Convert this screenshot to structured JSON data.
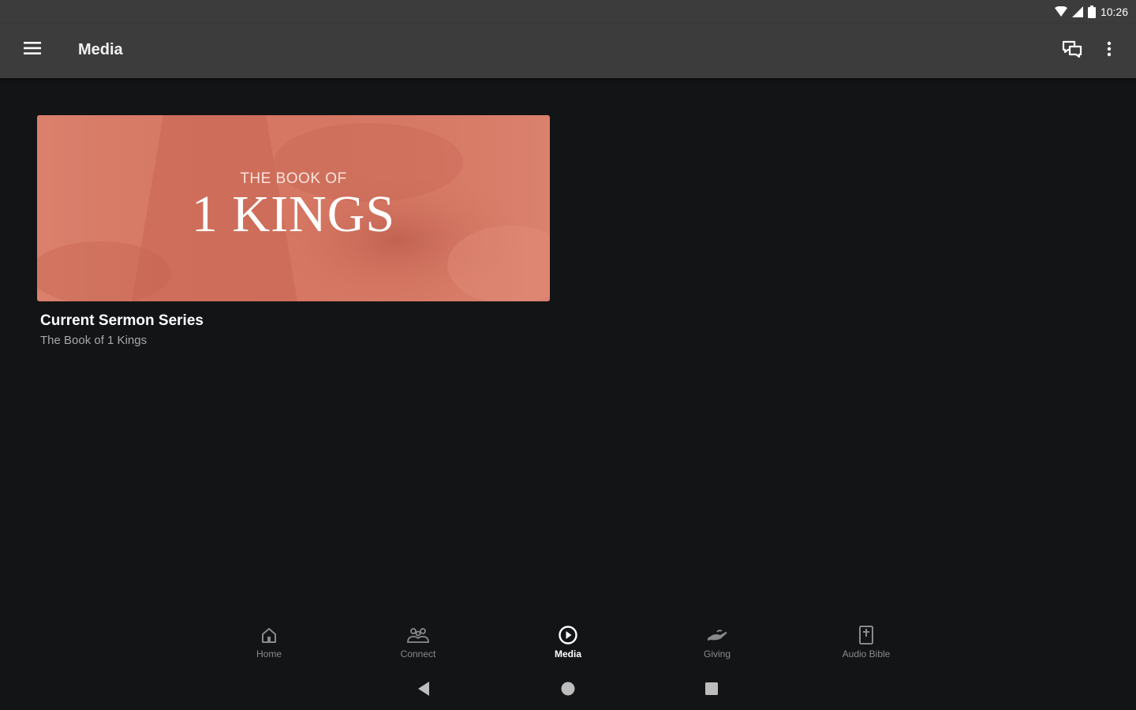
{
  "status_bar": {
    "time": "10:26",
    "icons": [
      "wifi-icon",
      "cell-signal-icon",
      "battery-icon"
    ]
  },
  "app_bar": {
    "title": "Media",
    "menu_icon": "hamburger-menu-icon",
    "actions": [
      "chat-icon",
      "more-vert-icon"
    ]
  },
  "media_card": {
    "banner_small_text": "THE BOOK OF",
    "banner_big_text": "1 KINGS",
    "title": "Current Sermon Series",
    "subtitle": "The Book of 1 Kings"
  },
  "bottom_nav": {
    "items": [
      {
        "label": "Home",
        "icon": "home-icon",
        "active": false
      },
      {
        "label": "Connect",
        "icon": "people-icon",
        "active": false
      },
      {
        "label": "Media",
        "icon": "play-circle-icon",
        "active": true
      },
      {
        "label": "Giving",
        "icon": "giving-hand-icon",
        "active": false
      },
      {
        "label": "Audio Bible",
        "icon": "bible-icon",
        "active": false
      }
    ]
  },
  "system_nav": [
    "back-icon",
    "home-circle-icon",
    "recents-icon"
  ],
  "colors": {
    "background": "#131416",
    "app_bar": "#3c3c3d",
    "banner": "#d57762",
    "inactive_nav": "#8a8a8a",
    "active_nav": "#ffffff"
  }
}
